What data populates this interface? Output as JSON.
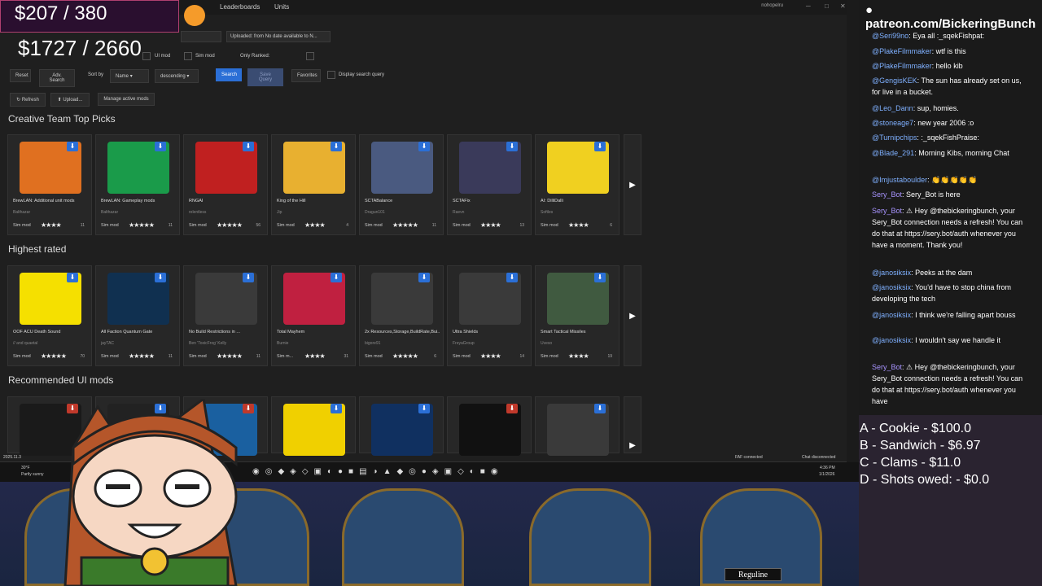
{
  "app": {
    "nav": [
      "Leaderboards",
      "Units"
    ],
    "user": "nohopelru",
    "money_top": "$207 / 380",
    "money_bottom": "$1727 / 2660"
  },
  "filters": {
    "uploaded": "Uploaded: from No date available to N...",
    "ui_mod": "UI mod",
    "sim_mod": "Sim mod",
    "only_ranked": "Only Ranked:",
    "reset": "Reset",
    "adv_search": "Adv. Search",
    "sort_by": "Sort by",
    "sort_field": "Name",
    "sort_order": "descending",
    "search": "Search",
    "save_query": "Save Query",
    "favorites": "Favorites",
    "display_query": "Display search query",
    "refresh": "Refresh",
    "upload": "Upload...",
    "manage": "Manage active mods"
  },
  "sections": [
    {
      "title": "Creative Team Top Picks",
      "cards": [
        {
          "title": "BrewLAN: Additional unit mods",
          "author": "Balthazar",
          "type": "Sim mod",
          "stars": "★★★★",
          "count": "11",
          "thumb": "#e07020"
        },
        {
          "title": "BrewLAN: Gameplay mods",
          "author": "Balthazar",
          "type": "Sim mod",
          "stars": "★★★★★",
          "count": "11",
          "thumb": "#1a9b4a"
        },
        {
          "title": "RNGAI",
          "author": "relentless",
          "type": "Sim mod",
          "stars": "★★★★★",
          "count": "56",
          "thumb": "#c02020"
        },
        {
          "title": "King of the Hill",
          "author": "Jip",
          "type": "Sim mod",
          "stars": "★★★★",
          "count": "4",
          "thumb": "#e8b030"
        },
        {
          "title": "SCTABalance",
          "author": "Dragun101",
          "type": "Sim mod",
          "stars": "★★★★★",
          "count": "11",
          "thumb": "#4a5a80"
        },
        {
          "title": "SCTAFix",
          "author": "Raevn",
          "type": "Sim mod",
          "stars": "★★★★",
          "count": "13",
          "thumb": "#3a3a5a"
        },
        {
          "title": "AI: DilliDalli",
          "author": "Softles",
          "type": "Sim mod",
          "stars": "★★★★",
          "count": "6",
          "thumb": "#f0d020"
        }
      ]
    },
    {
      "title": "Highest rated",
      "cards": [
        {
          "title": "OOF ACU Death Sound",
          "author": "// and quaetal",
          "type": "Sim mod",
          "stars": "★★★★★",
          "count": "70",
          "thumb": "#f5e000"
        },
        {
          "title": "All Faction Quantum Gate",
          "author": "jayTAC",
          "type": "Sim mod",
          "stars": "★★★★★",
          "count": "11",
          "thumb": "#103050"
        },
        {
          "title": "No Build Restrictions in ...",
          "author": "Ben 'ToxicFrog' Kelly",
          "type": "Sim mod",
          "stars": "★★★★★",
          "count": "11",
          "thumb": "#3a3a3a"
        },
        {
          "title": "Total Mayhem",
          "author": "Burnie",
          "type": "Sim m...",
          "stars": "★★★★",
          "count": "31",
          "thumb": "#c02040"
        },
        {
          "title": "2x Resources,Storage,BuildRate,Bui...",
          "author": "bigore91",
          "type": "Sim mod",
          "stars": "★★★★★",
          "count": "6",
          "thumb": "#3a3a3a"
        },
        {
          "title": "Ultra Shields",
          "author": "FreyaGroup",
          "type": "Sim mod",
          "stars": "★★★★",
          "count": "14",
          "thumb": "#3a3a3a"
        },
        {
          "title": "Smart Tactical Missiles",
          "author": "Uveso",
          "type": "Sim mod",
          "stars": "★★★★",
          "count": "19",
          "thumb": "#405a40"
        }
      ]
    },
    {
      "title": "Recommended UI mods",
      "cards": [
        {
          "thumb": "#1a1a1a"
        },
        {
          "thumb": "#222"
        },
        {
          "thumb": "#1a60a0"
        },
        {
          "thumb": "#f0d000"
        },
        {
          "thumb": "#103060"
        },
        {
          "thumb": "#111"
        },
        {
          "thumb": "#3a3a3a"
        }
      ]
    }
  ],
  "taskbar": {
    "version": "2025.11.3",
    "weather_temp": "30°F",
    "weather_desc": "Partly sunny",
    "faf": "FAF connected",
    "chat_status": "Chat disconnected",
    "time": "4:36 PM",
    "date": "1/1/2026"
  },
  "chat": {
    "patreon": "patreon.com/BickeringBunch",
    "messages": [
      {
        "user": "@Seri99no",
        "text": "Eya all :_sqekFishpat:"
      },
      {
        "user": "@PlakeFilmmaker",
        "text": "wtf is this"
      },
      {
        "user": "@PlakeFilmmaker",
        "text": "hello kib"
      },
      {
        "user": "@GengisKEK",
        "text": "The sun has already set on us, for live in a bucket."
      },
      {
        "user": "@Leo_Dann",
        "text": "sup, homies."
      },
      {
        "user": "@stoneage7",
        "text": "new year 2006 :o"
      },
      {
        "user": "@Turnipchips",
        "text": ":_sqekFishPraise:"
      },
      {
        "user": "@Blade_291",
        "text": "Morning Kibs, morning Chat"
      },
      {
        "user": "@Imjustaboulder",
        "text": "👏👏👏👏👏"
      },
      {
        "user": "Sery_Bot",
        "text": "Sery_Bot is here"
      },
      {
        "user": "Sery_Bot",
        "text": "⚠ Hey @thebickeringbunch, your Sery_Bot connection needs a refresh! You can do that at https://sery.bot/auth whenever you have a moment. Thank you!"
      },
      {
        "user": "@janosiksix",
        "text": "Peeks at the dam"
      },
      {
        "user": "@janosiksix",
        "text": "You'd have to stop china from developing the tech"
      },
      {
        "user": "@janosiksix",
        "text": "I think we're falling apart bouss"
      },
      {
        "user": "@janosiksix",
        "text": "I wouldn't say we handle it"
      },
      {
        "user": "Sery_Bot",
        "text": "⚠ Hey @thebickeringbunch, your Sery_Bot connection needs a refresh! You can do that at https://sery.bot/auth whenever you have"
      }
    ]
  },
  "votes": [
    "A - Cookie - $100.0",
    "B - Sandwich - $6.97",
    "C - Clams - $11.0",
    "D - Shots owed: - $0.0"
  ],
  "overlay": {
    "name": "Reguline"
  }
}
